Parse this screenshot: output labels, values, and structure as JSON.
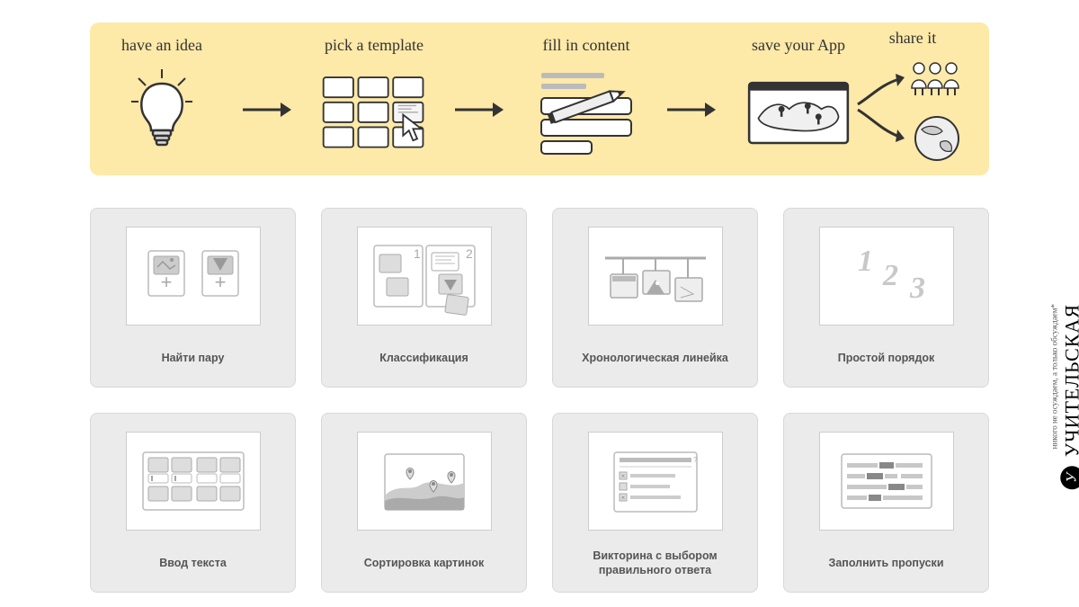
{
  "banner": {
    "steps": {
      "idea": "have an idea",
      "template": "pick a template",
      "content": "fill in content",
      "save": "save your App",
      "share": "share it"
    }
  },
  "templates": [
    {
      "title": "Найти пару"
    },
    {
      "title": "Классификация"
    },
    {
      "title": "Хронологическая линейка"
    },
    {
      "title": "Простой порядок"
    },
    {
      "title": "Ввод текста"
    },
    {
      "title": "Сортировка картинок"
    },
    {
      "title": "Викторина с выбором правильного ответа"
    },
    {
      "title": "Заполнить пропуски"
    }
  ],
  "watermark": {
    "badge": "У",
    "title": "УЧИТЕЛЬСКАЯ",
    "tagline": "никого не осуждаем, а только обсуждаем*"
  }
}
